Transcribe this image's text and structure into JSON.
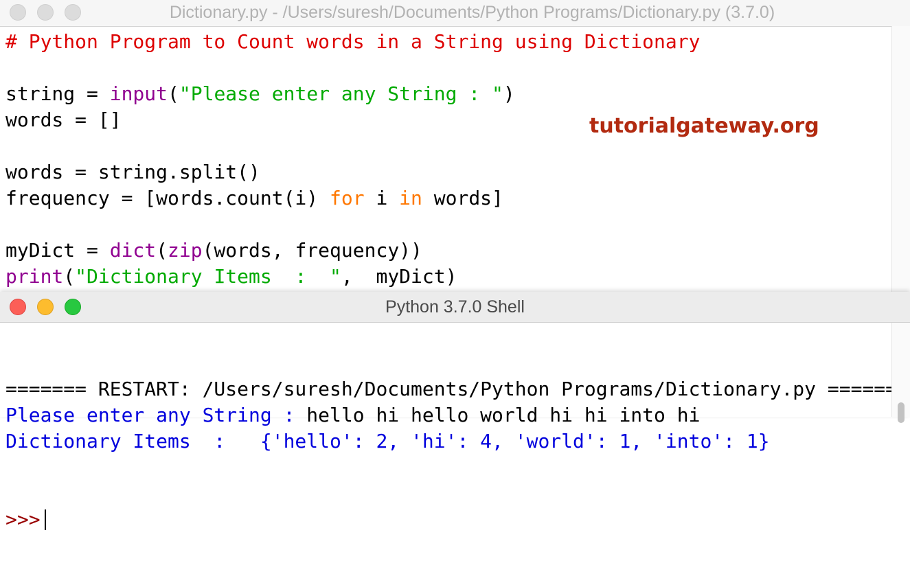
{
  "editor": {
    "title": "Dictionary.py - /Users/suresh/Documents/Python Programs/Dictionary.py (3.7.0)",
    "code_lines": [
      [
        {
          "t": "# Python Program to Count words in a String using Dictionary",
          "c": "comment"
        }
      ],
      [],
      [
        {
          "t": "string = ",
          "c": "plain"
        },
        {
          "t": "input",
          "c": "builtin"
        },
        {
          "t": "(",
          "c": "plain"
        },
        {
          "t": "\"Please enter any String : \"",
          "c": "string"
        },
        {
          "t": ")",
          "c": "plain"
        }
      ],
      [
        {
          "t": "words = []",
          "c": "plain"
        }
      ],
      [],
      [
        {
          "t": "words = string.split()",
          "c": "plain"
        }
      ],
      [
        {
          "t": "frequency = [words.count(i) ",
          "c": "plain"
        },
        {
          "t": "for",
          "c": "keyword"
        },
        {
          "t": " i ",
          "c": "plain"
        },
        {
          "t": "in",
          "c": "keyword"
        },
        {
          "t": " words]",
          "c": "plain"
        }
      ],
      [],
      [
        {
          "t": "myDict = ",
          "c": "plain"
        },
        {
          "t": "dict",
          "c": "builtin"
        },
        {
          "t": "(",
          "c": "plain"
        },
        {
          "t": "zip",
          "c": "builtin"
        },
        {
          "t": "(words, frequency))",
          "c": "plain"
        }
      ],
      [
        {
          "t": "print",
          "c": "builtin"
        },
        {
          "t": "(",
          "c": "plain"
        },
        {
          "t": "\"Dictionary Items  :  \"",
          "c": "string"
        },
        {
          "t": ",  myDict)",
          "c": "plain"
        }
      ]
    ]
  },
  "watermark": "tutorialgateway.org",
  "shell": {
    "title": "Python 3.7.0 Shell",
    "output_lines": [
      [
        {
          "t": "======= RESTART: /Users/suresh/Documents/Python Programs/Dictionary.py =======",
          "c": "plain"
        }
      ],
      [
        {
          "t": "Please enter any String : ",
          "c": "stdout"
        },
        {
          "t": "hello hi hello world hi hi into hi",
          "c": "plain"
        }
      ],
      [
        {
          "t": "Dictionary Items  :   {'hello': 2, 'hi': 4, 'world': 1, 'into': 1}",
          "c": "stdout"
        }
      ]
    ],
    "prompt": ">>>"
  },
  "colors": {
    "comment": "#dd0000",
    "builtin": "#900090",
    "string": "#00aa00",
    "keyword": "#ff7700",
    "stdout": "#0000dd",
    "prompt": "#990000",
    "watermark": "#b22a10"
  }
}
